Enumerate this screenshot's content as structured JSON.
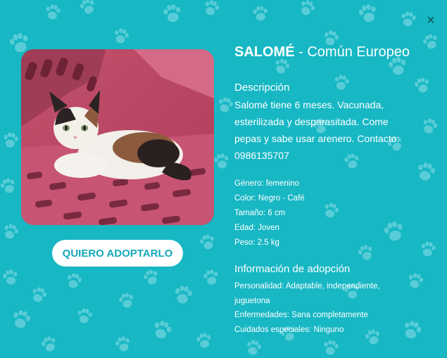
{
  "modal": {
    "close_label": "×",
    "pet": {
      "name": "SALOMÉ",
      "separator": " - ",
      "breed": "Común Europeo"
    },
    "adopt_button": "QUIERO ADOPTARLO",
    "description": {
      "title": "Descripción",
      "text": "Salomé tiene 6 meses. Vacunada, esterilizada y desparasitada. Come pepas y sabe usar arenero. Contacto: 0986135707"
    },
    "details": [
      "Género: femenino",
      "Color: Negro - Café",
      "Tamaño: 6 cm",
      "Edad: Joven",
      "Peso: 2.5 kg"
    ],
    "adoption": {
      "title": "Información de adopción",
      "items": [
        "Personalidad: Adaptable, independiente, juguetona",
        "Enfermedades: Sana completamente",
        "Cuidados especiales: Ninguno"
      ]
    },
    "colors": {
      "background": "#17b7c4",
      "button_text": "#13a9b9",
      "paw_pattern": "#8fe0e8"
    }
  }
}
